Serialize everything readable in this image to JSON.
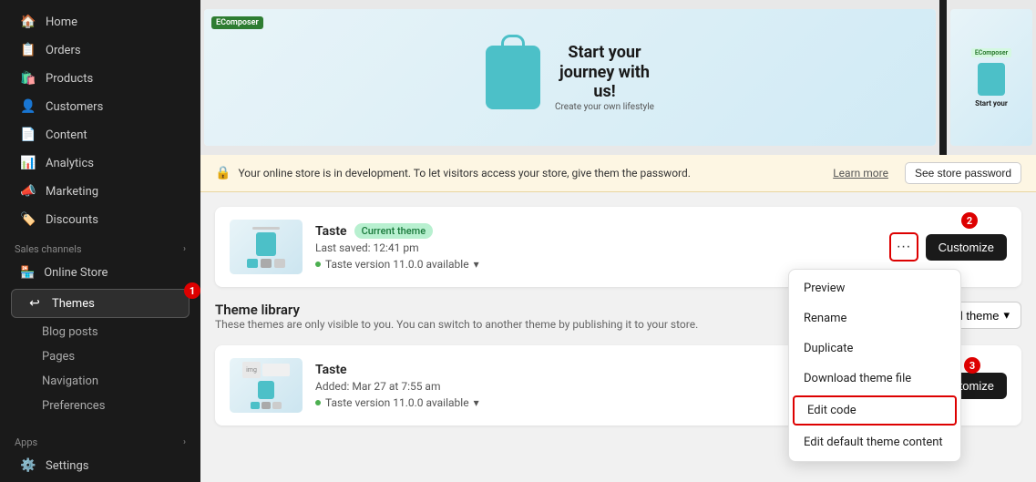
{
  "sidebar": {
    "items": [
      {
        "id": "home",
        "label": "Home",
        "icon": "🏠"
      },
      {
        "id": "orders",
        "label": "Orders",
        "icon": "📋"
      },
      {
        "id": "products",
        "label": "Products",
        "icon": "🛍️"
      },
      {
        "id": "customers",
        "label": "Customers",
        "icon": "👤"
      },
      {
        "id": "content",
        "label": "Content",
        "icon": "📄"
      },
      {
        "id": "analytics",
        "label": "Analytics",
        "icon": "📊"
      },
      {
        "id": "marketing",
        "label": "Marketing",
        "icon": "📣"
      },
      {
        "id": "discounts",
        "label": "Discounts",
        "icon": "🏷️"
      }
    ],
    "sales_channels_label": "Sales channels",
    "online_store_label": "Online Store",
    "themes_label": "Themes",
    "sub_items": [
      {
        "id": "blog-posts",
        "label": "Blog posts"
      },
      {
        "id": "pages",
        "label": "Pages"
      },
      {
        "id": "navigation",
        "label": "Navigation"
      },
      {
        "id": "preferences",
        "label": "Preferences"
      }
    ],
    "apps_label": "Apps",
    "settings_label": "Settings"
  },
  "banner": {
    "message": "Your online store is in development. To let visitors access your store, give them the password.",
    "learn_more": "Learn more",
    "password_btn": "See store password"
  },
  "current_theme": {
    "name": "Taste",
    "badge": "Current theme",
    "last_saved": "Last saved: 12:41 pm",
    "version": "Taste version 11.0.0 available",
    "customize_label": "Customize"
  },
  "dropdown": {
    "items": [
      {
        "id": "preview",
        "label": "Preview",
        "highlighted": false
      },
      {
        "id": "rename",
        "label": "Rename",
        "highlighted": false
      },
      {
        "id": "duplicate",
        "label": "Duplicate",
        "highlighted": false
      },
      {
        "id": "download",
        "label": "Download theme file",
        "highlighted": false
      },
      {
        "id": "edit-code",
        "label": "Edit code",
        "highlighted": true
      },
      {
        "id": "edit-default",
        "label": "Edit default theme content",
        "highlighted": false
      }
    ]
  },
  "library": {
    "title": "Theme library",
    "description": "These themes are only visible to you. You can switch to another theme by publishing it to your store.",
    "add_theme_label": "Add theme",
    "themes": [
      {
        "name": "Taste",
        "added": "Added: Mar 27 at 7:55 am",
        "version": "Taste version 11.0.0 available",
        "customize_label": "Customize"
      }
    ]
  },
  "annotations": {
    "badge1": "1",
    "badge2": "2",
    "badge3": "3"
  },
  "preview": {
    "heading_line1": "Start your",
    "heading_line2": "journey with",
    "heading_line3": "us!",
    "sub": "Create your own lifestyle",
    "composer_label": "EComposer",
    "mobile_heading": "Start your"
  }
}
